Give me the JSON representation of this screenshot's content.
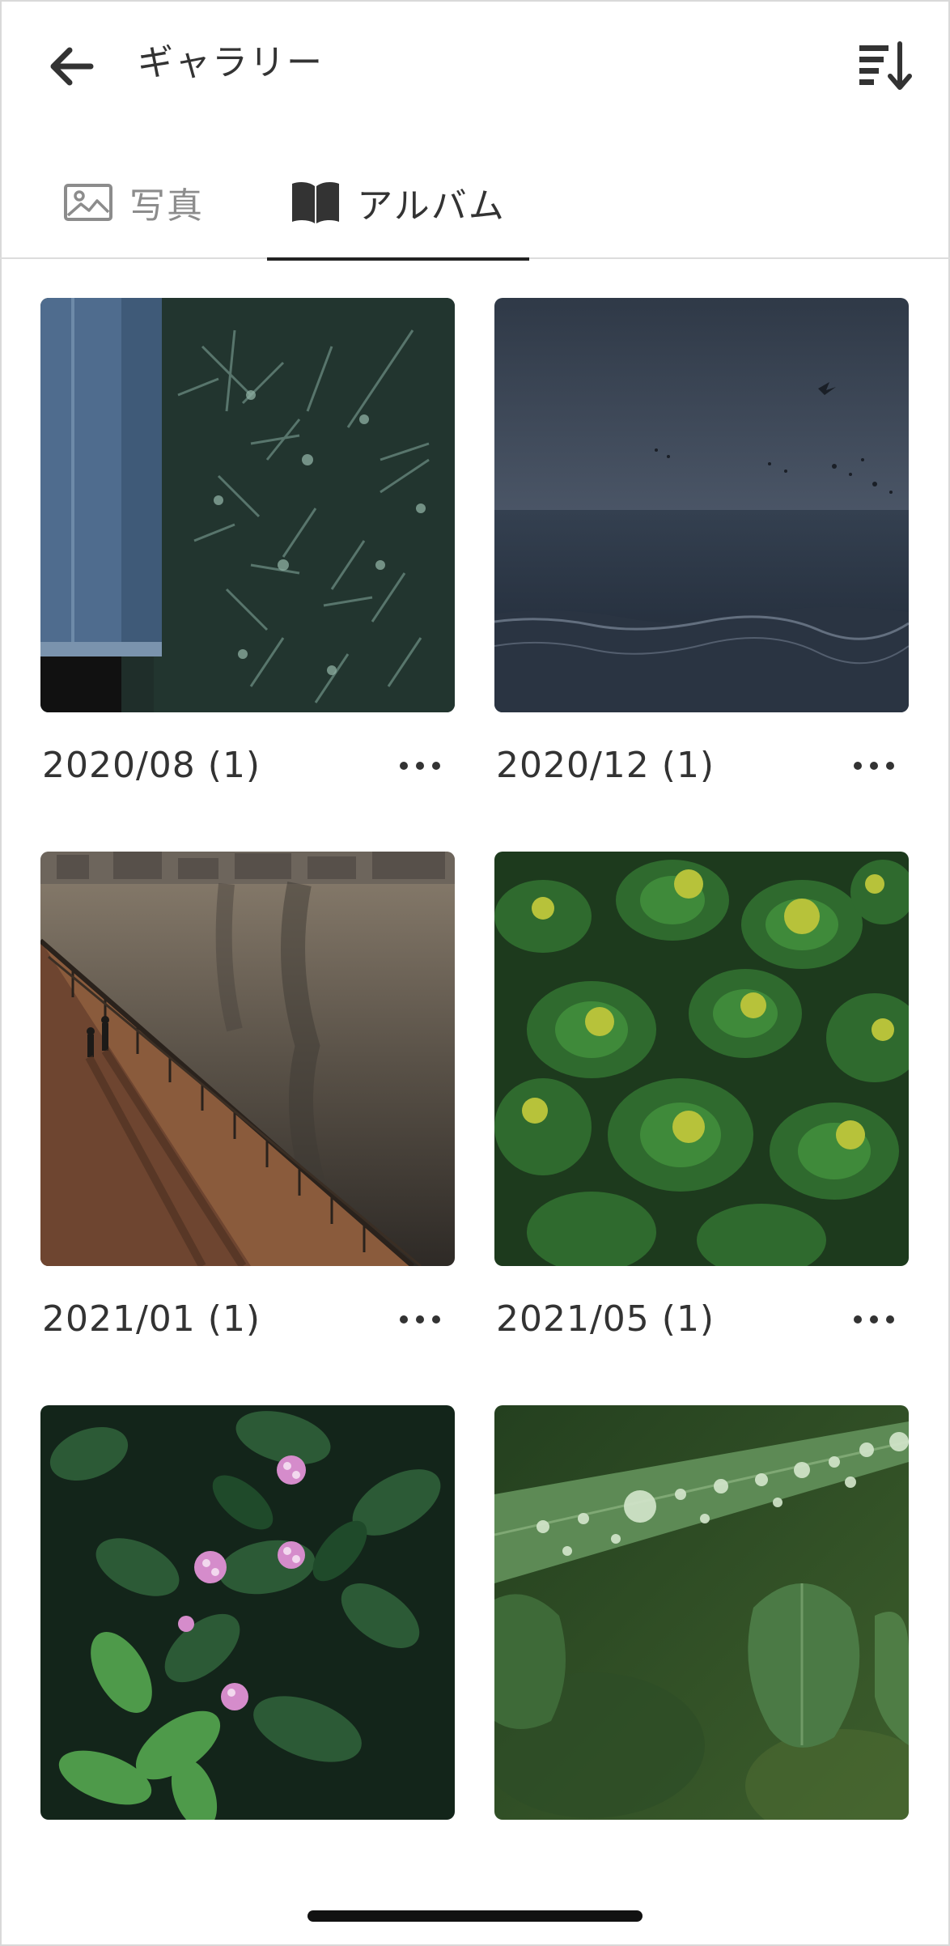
{
  "header": {
    "title": "ギャラリー",
    "back_icon": "arrow-left-icon",
    "sort_icon": "sort-descending-icon"
  },
  "tabs": [
    {
      "label": "写真",
      "icon": "image-icon",
      "selected": false
    },
    {
      "label": "アルバム",
      "icon": "book-open-icon",
      "selected": true
    }
  ],
  "albums": [
    {
      "caption": "2020/08 (1)",
      "more_icon": "more-horizontal-icon",
      "thumbnail": "jeans-and-green-plants-photo"
    },
    {
      "caption": "2020/12 (1)",
      "more_icon": "more-horizontal-icon",
      "thumbnail": "dark-sea-and-birds-photo"
    },
    {
      "caption": "2021/01 (1)",
      "more_icon": "more-horizontal-icon",
      "thumbnail": "riverside-walkway-photo"
    },
    {
      "caption": "2021/05 (1)",
      "more_icon": "more-horizontal-icon",
      "thumbnail": "green-succulent-plants-photo"
    },
    {
      "caption": "",
      "more_icon": "",
      "thumbnail": "pink-flower-buds-photo"
    },
    {
      "caption": "",
      "more_icon": "",
      "thumbnail": "dew-drops-on-leaf-photo"
    }
  ],
  "colors": {
    "text_primary": "#333333",
    "text_secondary": "#8c8c8c",
    "tab_indicator": "#222222",
    "divider": "#dcdcdc"
  }
}
